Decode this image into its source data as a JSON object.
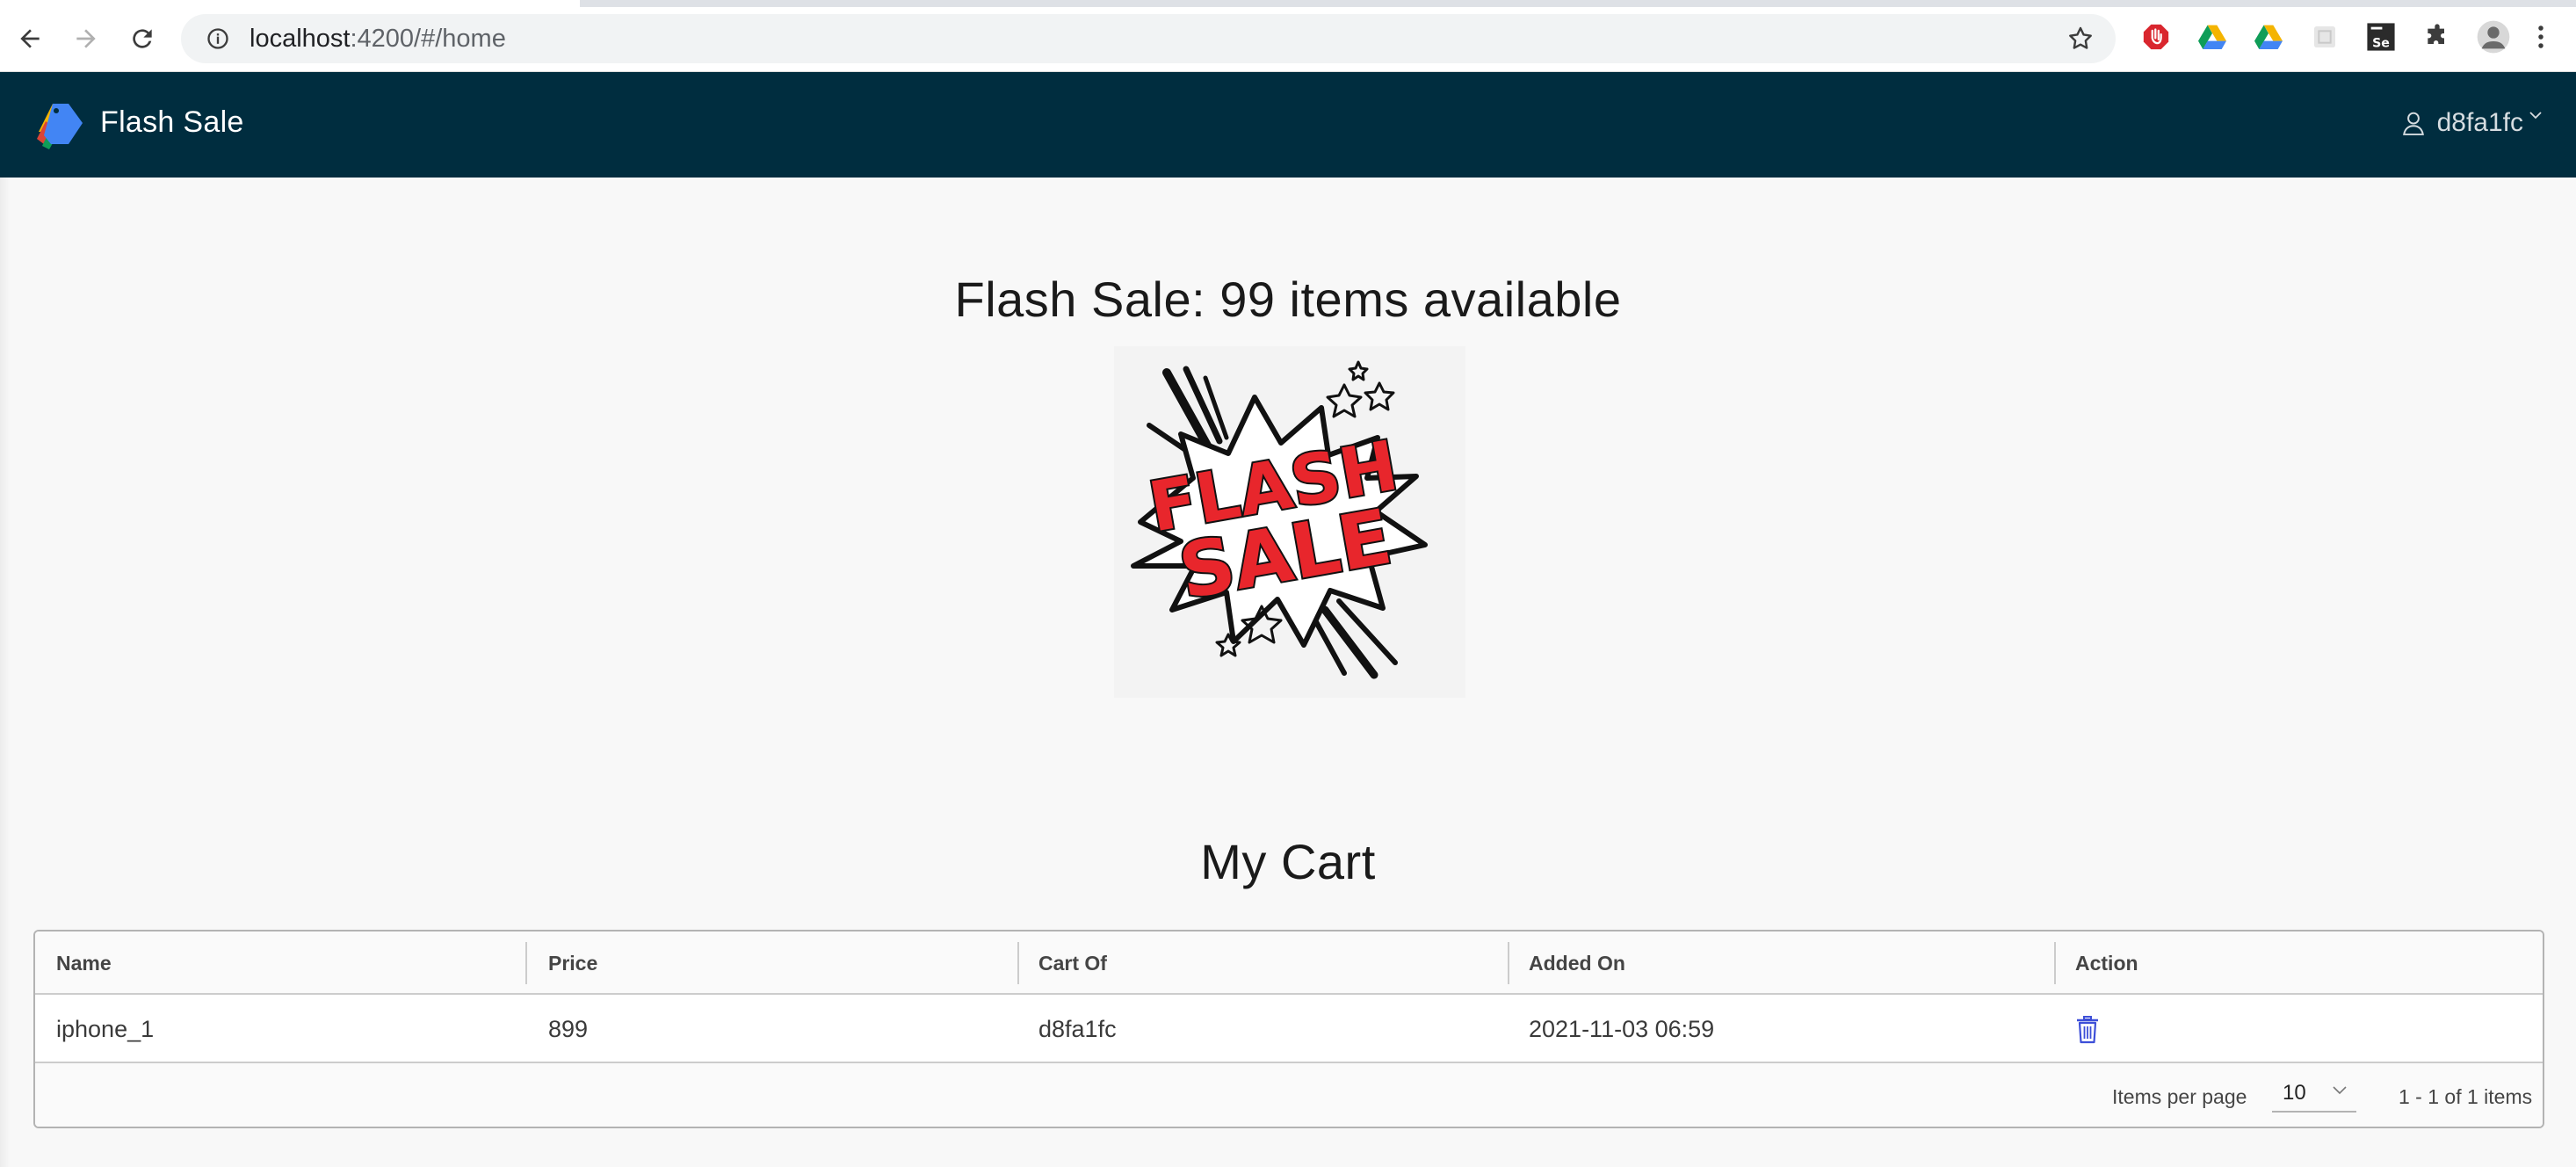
{
  "browser": {
    "url_host": "localhost",
    "url_rest": ":4200/#/home"
  },
  "header": {
    "app_title": "Flash Sale",
    "username": "d8fa1fc"
  },
  "main": {
    "sale_heading": "Flash Sale: 99 items available",
    "sale_image_text_line1": "FLASH",
    "sale_image_text_line2": "SALE",
    "cart_heading": "My Cart"
  },
  "cart_table": {
    "columns": [
      "Name",
      "Price",
      "Cart Of",
      "Added On",
      "Action"
    ],
    "rows": [
      {
        "name": "iphone_1",
        "price": "899",
        "cart_of": "d8fa1fc",
        "added_on": "2021-11-03 06:59",
        "action_icon": "trash-icon"
      }
    ],
    "footer": {
      "items_per_page_label": "Items per page",
      "page_size": "10",
      "pagination_summary": "1 - 1 of 1 items"
    }
  },
  "colors": {
    "header_bg": "#002d3f",
    "page_bg": "#f8f8f8",
    "delete_icon": "#3d4fd8",
    "sale_red": "#e8262c"
  }
}
